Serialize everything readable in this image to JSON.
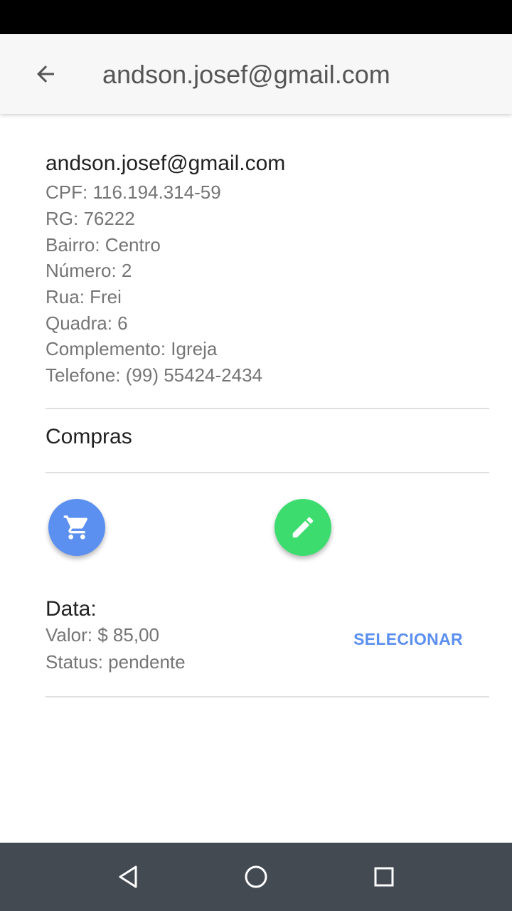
{
  "app_bar": {
    "title": "andson.josef@gmail.com",
    "back_icon": "arrow-back-icon"
  },
  "user": {
    "email": "andson.josef@gmail.com",
    "cpf": "CPF: 116.194.314-59",
    "rg": "RG: 76222",
    "bairro": "Bairro: Centro",
    "numero": "Número: 2",
    "rua": "Rua: Frei",
    "quadra": "Quadra: 6",
    "complemento": "Complemento: Igreja",
    "telefone": "Telefone: (99) 55424-2434"
  },
  "purchases": {
    "section_title": "Compras",
    "cart_button": {
      "icon": "shopping-cart-icon",
      "color": "#5b8ff0"
    },
    "edit_button": {
      "icon": "pencil-icon",
      "color": "#3ddc6f"
    },
    "items": [
      {
        "date": "Data:",
        "value": "Valor: $ 85,00",
        "status": "Status: pendente",
        "select_label": "SELECIONAR"
      }
    ]
  },
  "system_nav": {
    "back_icon": "triangle-back-icon",
    "home_icon": "circle-home-icon",
    "recents_icon": "square-recents-icon",
    "background": "#434a52"
  },
  "colors": {
    "accent": "#5b8ff0",
    "success": "#3ddc6f",
    "primary_text": "#212121",
    "secondary_text": "#757575"
  }
}
